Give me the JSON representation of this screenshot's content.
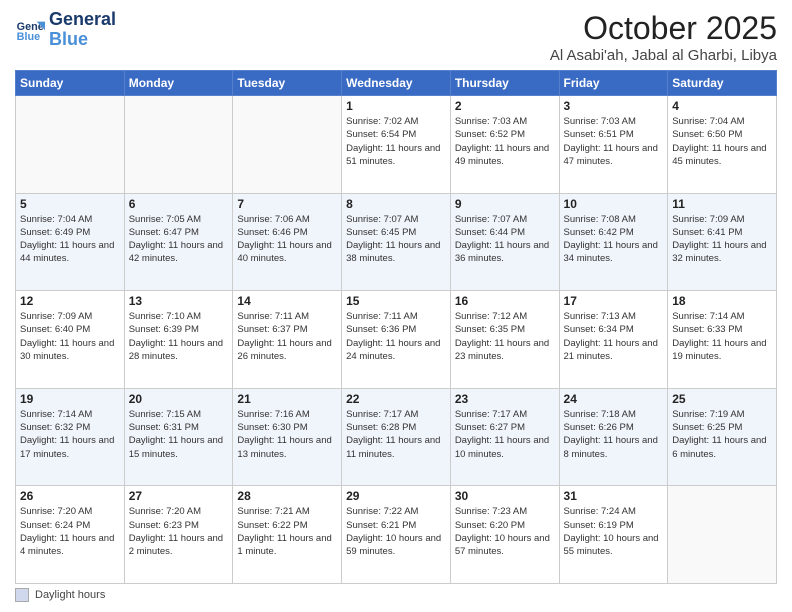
{
  "header": {
    "logo_line1": "General",
    "logo_line2": "Blue",
    "title": "October 2025",
    "subtitle": "Al Asabi'ah, Jabal al Gharbi, Libya"
  },
  "weekdays": [
    "Sunday",
    "Monday",
    "Tuesday",
    "Wednesday",
    "Thursday",
    "Friday",
    "Saturday"
  ],
  "weeks": [
    [
      {
        "day": "",
        "info": ""
      },
      {
        "day": "",
        "info": ""
      },
      {
        "day": "",
        "info": ""
      },
      {
        "day": "1",
        "info": "Sunrise: 7:02 AM\nSunset: 6:54 PM\nDaylight: 11 hours and 51 minutes."
      },
      {
        "day": "2",
        "info": "Sunrise: 7:03 AM\nSunset: 6:52 PM\nDaylight: 11 hours and 49 minutes."
      },
      {
        "day": "3",
        "info": "Sunrise: 7:03 AM\nSunset: 6:51 PM\nDaylight: 11 hours and 47 minutes."
      },
      {
        "day": "4",
        "info": "Sunrise: 7:04 AM\nSunset: 6:50 PM\nDaylight: 11 hours and 45 minutes."
      }
    ],
    [
      {
        "day": "5",
        "info": "Sunrise: 7:04 AM\nSunset: 6:49 PM\nDaylight: 11 hours and 44 minutes."
      },
      {
        "day": "6",
        "info": "Sunrise: 7:05 AM\nSunset: 6:47 PM\nDaylight: 11 hours and 42 minutes."
      },
      {
        "day": "7",
        "info": "Sunrise: 7:06 AM\nSunset: 6:46 PM\nDaylight: 11 hours and 40 minutes."
      },
      {
        "day": "8",
        "info": "Sunrise: 7:07 AM\nSunset: 6:45 PM\nDaylight: 11 hours and 38 minutes."
      },
      {
        "day": "9",
        "info": "Sunrise: 7:07 AM\nSunset: 6:44 PM\nDaylight: 11 hours and 36 minutes."
      },
      {
        "day": "10",
        "info": "Sunrise: 7:08 AM\nSunset: 6:42 PM\nDaylight: 11 hours and 34 minutes."
      },
      {
        "day": "11",
        "info": "Sunrise: 7:09 AM\nSunset: 6:41 PM\nDaylight: 11 hours and 32 minutes."
      }
    ],
    [
      {
        "day": "12",
        "info": "Sunrise: 7:09 AM\nSunset: 6:40 PM\nDaylight: 11 hours and 30 minutes."
      },
      {
        "day": "13",
        "info": "Sunrise: 7:10 AM\nSunset: 6:39 PM\nDaylight: 11 hours and 28 minutes."
      },
      {
        "day": "14",
        "info": "Sunrise: 7:11 AM\nSunset: 6:37 PM\nDaylight: 11 hours and 26 minutes."
      },
      {
        "day": "15",
        "info": "Sunrise: 7:11 AM\nSunset: 6:36 PM\nDaylight: 11 hours and 24 minutes."
      },
      {
        "day": "16",
        "info": "Sunrise: 7:12 AM\nSunset: 6:35 PM\nDaylight: 11 hours and 23 minutes."
      },
      {
        "day": "17",
        "info": "Sunrise: 7:13 AM\nSunset: 6:34 PM\nDaylight: 11 hours and 21 minutes."
      },
      {
        "day": "18",
        "info": "Sunrise: 7:14 AM\nSunset: 6:33 PM\nDaylight: 11 hours and 19 minutes."
      }
    ],
    [
      {
        "day": "19",
        "info": "Sunrise: 7:14 AM\nSunset: 6:32 PM\nDaylight: 11 hours and 17 minutes."
      },
      {
        "day": "20",
        "info": "Sunrise: 7:15 AM\nSunset: 6:31 PM\nDaylight: 11 hours and 15 minutes."
      },
      {
        "day": "21",
        "info": "Sunrise: 7:16 AM\nSunset: 6:30 PM\nDaylight: 11 hours and 13 minutes."
      },
      {
        "day": "22",
        "info": "Sunrise: 7:17 AM\nSunset: 6:28 PM\nDaylight: 11 hours and 11 minutes."
      },
      {
        "day": "23",
        "info": "Sunrise: 7:17 AM\nSunset: 6:27 PM\nDaylight: 11 hours and 10 minutes."
      },
      {
        "day": "24",
        "info": "Sunrise: 7:18 AM\nSunset: 6:26 PM\nDaylight: 11 hours and 8 minutes."
      },
      {
        "day": "25",
        "info": "Sunrise: 7:19 AM\nSunset: 6:25 PM\nDaylight: 11 hours and 6 minutes."
      }
    ],
    [
      {
        "day": "26",
        "info": "Sunrise: 7:20 AM\nSunset: 6:24 PM\nDaylight: 11 hours and 4 minutes."
      },
      {
        "day": "27",
        "info": "Sunrise: 7:20 AM\nSunset: 6:23 PM\nDaylight: 11 hours and 2 minutes."
      },
      {
        "day": "28",
        "info": "Sunrise: 7:21 AM\nSunset: 6:22 PM\nDaylight: 11 hours and 1 minute."
      },
      {
        "day": "29",
        "info": "Sunrise: 7:22 AM\nSunset: 6:21 PM\nDaylight: 10 hours and 59 minutes."
      },
      {
        "day": "30",
        "info": "Sunrise: 7:23 AM\nSunset: 6:20 PM\nDaylight: 10 hours and 57 minutes."
      },
      {
        "day": "31",
        "info": "Sunrise: 7:24 AM\nSunset: 6:19 PM\nDaylight: 10 hours and 55 minutes."
      },
      {
        "day": "",
        "info": ""
      }
    ]
  ],
  "footer": {
    "legend_label": "Daylight hours"
  }
}
